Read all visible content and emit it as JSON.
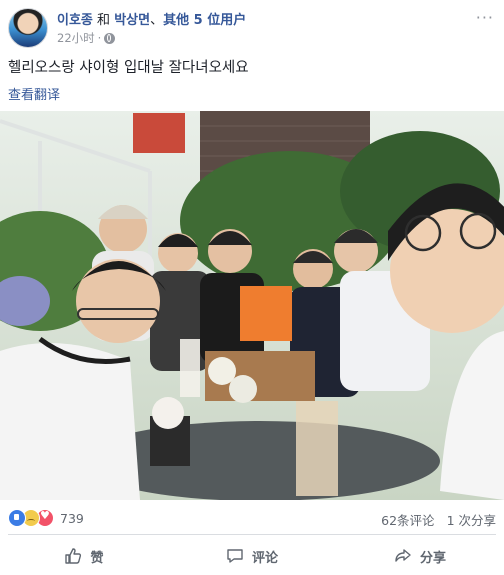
{
  "post": {
    "author_primary": "이호종",
    "connector_and": "和",
    "author_secondary": "박상면",
    "separator": "、",
    "others": "其他 5 位用户",
    "time": "22小时",
    "time_dot": "·",
    "more_label": "···",
    "text": "헬리오스랑 샤이형 입대날 잘다녀오세요",
    "translate_label": "查看翻译"
  },
  "stats": {
    "reaction_count": "739",
    "comments": "62条评论",
    "shares": "1 次分享"
  },
  "actions": {
    "like": "赞",
    "comment": "评论",
    "share": "分享"
  },
  "icons": {
    "privacy": "globe-icon",
    "reactions": [
      "like-icon",
      "sad-icon",
      "love-icon"
    ]
  }
}
